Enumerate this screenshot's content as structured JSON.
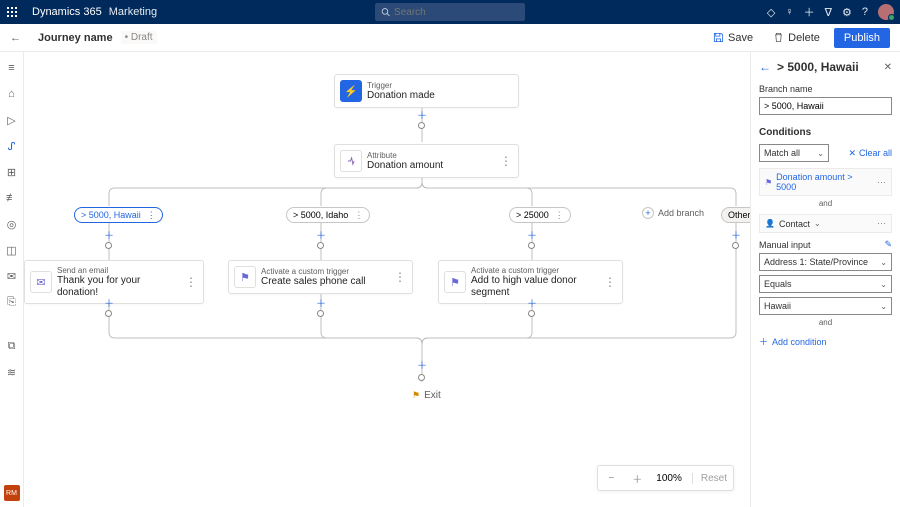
{
  "app": {
    "brand": "Dynamics 365",
    "module": "Marketing",
    "search_placeholder": "Search"
  },
  "header": {
    "title": "Journey name",
    "status": "Draft",
    "save": "Save",
    "delete": "Delete",
    "publish": "Publish"
  },
  "rail": {
    "rm": "RM"
  },
  "canvas": {
    "trigger": {
      "label": "Trigger",
      "value": "Donation made"
    },
    "attribute": {
      "label": "Attribute",
      "value": "Donation amount"
    },
    "branches": {
      "b1": "> 5000, Hawaii",
      "b2": "> 5000, Idaho",
      "b3": "> 25000",
      "add": "Add branch",
      "other": "Other"
    },
    "actions": {
      "a1": {
        "label": "Send an email",
        "value": "Thank you for your donation!"
      },
      "a2": {
        "label": "Activate a custom trigger",
        "value": "Create sales phone call"
      },
      "a3": {
        "label": "Activate a custom trigger",
        "value": "Add to high value donor segment"
      }
    },
    "exit": "Exit",
    "zoom": {
      "level": "100%",
      "reset": "Reset"
    }
  },
  "panel": {
    "title": "> 5000, Hawaii",
    "branch_name_label": "Branch name",
    "branch_name_value": "> 5000, Hawaii",
    "conditions_label": "Conditions",
    "match_mode": "Match all",
    "clear_all": "Clear all",
    "cond1": "Donation amount > 5000",
    "and": "and",
    "cond2_entity": "Contact",
    "manual_input": "Manual input",
    "field1": "Address 1: State/Province",
    "op": "Equals",
    "value": "Hawaii",
    "add_condition": "Add condition"
  }
}
